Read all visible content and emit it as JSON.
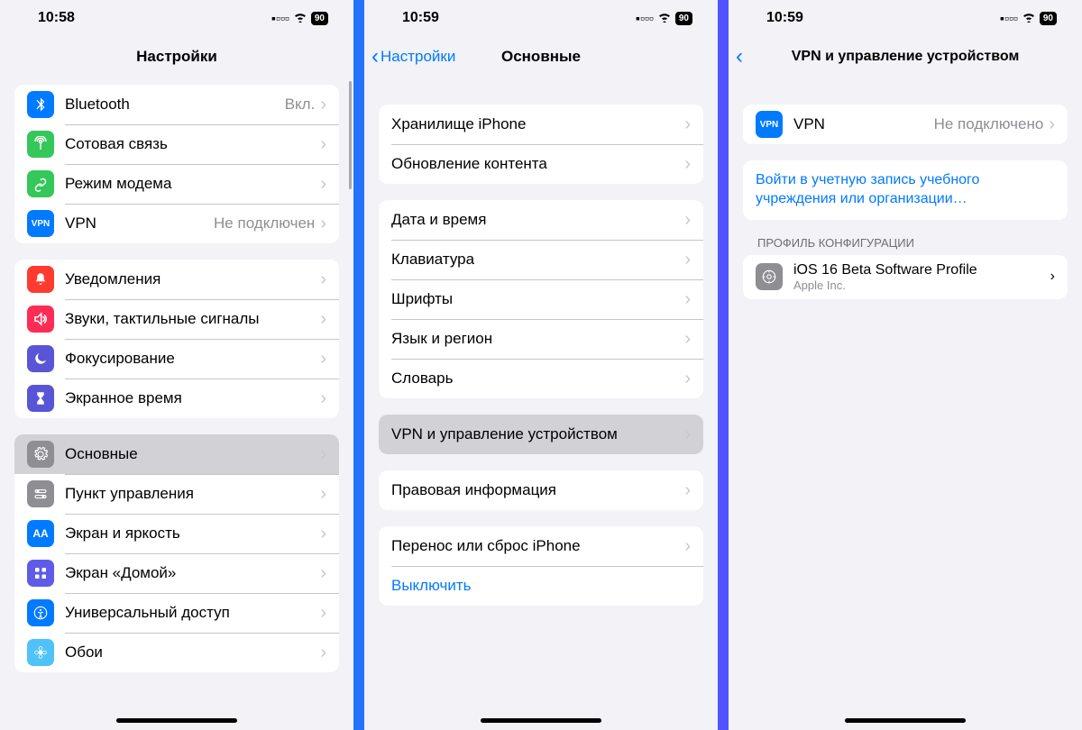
{
  "status": {
    "battery": "90"
  },
  "screen1": {
    "time": "10:58",
    "title": "Настройки",
    "g1": [
      {
        "label": "Bluetooth",
        "detail": "Вкл.",
        "icon": "bluetooth",
        "bg": "bg-blue"
      },
      {
        "label": "Сотовая связь",
        "detail": "",
        "icon": "antenna",
        "bg": "bg-green"
      },
      {
        "label": "Режим модема",
        "detail": "",
        "icon": "link",
        "bg": "bg-green"
      },
      {
        "label": "VPN",
        "detail": "Не подключен",
        "icon": "vpn",
        "bg": "bg-blue"
      }
    ],
    "g2": [
      {
        "label": "Уведомления",
        "icon": "bell",
        "bg": "bg-red"
      },
      {
        "label": "Звуки, тактильные сигналы",
        "icon": "speaker",
        "bg": "bg-red2"
      },
      {
        "label": "Фокусирование",
        "icon": "moon",
        "bg": "bg-indigo"
      },
      {
        "label": "Экранное время",
        "icon": "hourglass",
        "bg": "bg-indigo"
      }
    ],
    "g3": [
      {
        "label": "Основные",
        "icon": "gear",
        "bg": "bg-gray",
        "selected": true
      },
      {
        "label": "Пункт управления",
        "icon": "switches",
        "bg": "bg-gray"
      },
      {
        "label": "Экран и яркость",
        "icon": "aa",
        "bg": "bg-blue"
      },
      {
        "label": "Экран «Домой»",
        "icon": "grid",
        "bg": "bg-purple"
      },
      {
        "label": "Универсальный доступ",
        "icon": "access",
        "bg": "bg-blue"
      },
      {
        "label": "Обои",
        "icon": "flower",
        "bg": "bg-blue"
      }
    ]
  },
  "screen2": {
    "time": "10:59",
    "back": "Настройки",
    "title": "Основные",
    "g1": [
      {
        "label": "Хранилище iPhone"
      },
      {
        "label": "Обновление контента"
      }
    ],
    "g2": [
      {
        "label": "Дата и время"
      },
      {
        "label": "Клавиатура"
      },
      {
        "label": "Шрифты"
      },
      {
        "label": "Язык и регион"
      },
      {
        "label": "Словарь"
      }
    ],
    "g3": [
      {
        "label": "VPN и управление устройством",
        "selected": true
      }
    ],
    "g4": [
      {
        "label": "Правовая информация"
      }
    ],
    "g5": [
      {
        "label": "Перенос или сброс iPhone"
      },
      {
        "label": "Выключить",
        "blue": true,
        "nochev": true
      }
    ]
  },
  "screen3": {
    "time": "10:59",
    "title": "VPN и управление устройством",
    "vpn": {
      "label": "VPN",
      "detail": "Не подключено"
    },
    "signin": "Войти в учетную запись учебного учреждения или организации…",
    "section_header": "ПРОФИЛЬ КОНФИГУРАЦИИ",
    "profile": {
      "title": "iOS 16 Beta Software Profile",
      "sub": "Apple Inc."
    }
  }
}
